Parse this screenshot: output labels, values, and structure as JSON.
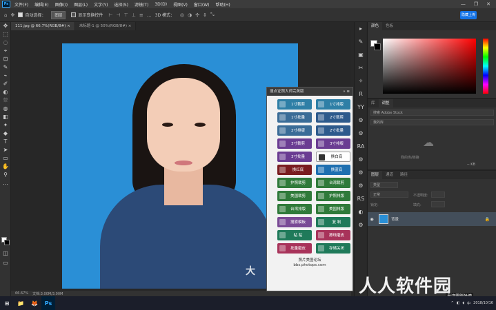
{
  "menubar": {
    "logo": "Ps",
    "items": [
      "文件(F)",
      "编辑(E)",
      "图像(I)",
      "图层(L)",
      "文字(Y)",
      "选择(S)",
      "滤镜(T)",
      "3D(D)",
      "视图(V)",
      "窗口(W)",
      "帮助(H)"
    ],
    "window_controls": [
      "—",
      "❐",
      "✕"
    ]
  },
  "options_bar": {
    "auto_select_label": "自动选择：",
    "auto_select_value": "图层",
    "show_transform_label": "显示变换控件",
    "mode_3d": "3D 模式：",
    "cloud_button": "隐藏上传"
  },
  "tabs": [
    {
      "label": "111.jpg @ 66.7%(RGB/8#) ×",
      "active": true
    },
    {
      "label": "未标题-1 @ 50%(RGB/8#) ×",
      "active": false
    }
  ],
  "tools": [
    "✥",
    "⬚",
    "◌",
    "⌖",
    "⊡",
    "✎",
    "⌁",
    "✐",
    "◐",
    "⛆",
    "◍",
    "◧",
    "✦",
    "◆",
    "T",
    "➤",
    "▭",
    "✋",
    "⚲",
    "…"
  ],
  "photo": {
    "watermark": "大"
  },
  "statusbar": {
    "zoom": "66.67%",
    "doc": "文档:3.00M/3.00M"
  },
  "plugin": {
    "title": "搜点证照大师完美版",
    "header_icons": "» ≡",
    "buttons": [
      {
        "label": "1寸裁剪",
        "color": "#2e7fa6"
      },
      {
        "label": "1寸排版",
        "color": "#2e7fa6"
      },
      {
        "label": "1寸批量",
        "color": "#3a6c97"
      },
      {
        "label": "2寸裁剪",
        "color": "#2d5a8c"
      },
      {
        "label": "2寸排版",
        "color": "#3a6c97"
      },
      {
        "label": "2寸批量",
        "color": "#2d5a8c"
      },
      {
        "label": "3寸裁剪",
        "color": "#6a3c92"
      },
      {
        "label": "3寸排版",
        "color": "#6a3c92"
      },
      {
        "label": "3寸批量",
        "color": "#6a3c92"
      },
      {
        "label": "换白底",
        "color": "#ffffff"
      },
      {
        "label": "换红底",
        "color": "#7a1c20"
      },
      {
        "label": "换蓝底",
        "color": "#1e6fb0"
      },
      {
        "label": "护照裁剪",
        "color": "#2f7a3a"
      },
      {
        "label": "台湾裁剪",
        "color": "#2f7a3a"
      },
      {
        "label": "美国裁剪",
        "color": "#2f7a3a"
      },
      {
        "label": "护照排版",
        "color": "#2f7a3a"
      },
      {
        "label": "台湾排版",
        "color": "#2f7a3a"
      },
      {
        "label": "美国排版",
        "color": "#2f7a3a"
      },
      {
        "label": "搜索模板",
        "color": "#7a4a96"
      },
      {
        "label": "复 制",
        "color": "#1f7a5a"
      },
      {
        "label": "粘 贴",
        "color": "#1f7a5a"
      },
      {
        "label": "擦线磨皮",
        "color": "#a8335a"
      },
      {
        "label": "批量磨皮",
        "color": "#a8335a"
      },
      {
        "label": "存储关闭",
        "color": "#1f7a5a"
      }
    ],
    "footer_line1": "照片美图论坛",
    "footer_line2": "bbs.photops.com"
  },
  "icon_strip": [
    "▸",
    "✎",
    "▣",
    "✂",
    "✧",
    "R",
    "YY",
    "⚙",
    "⚙",
    "RA",
    "⚙",
    "⚙",
    "⚙",
    "RS",
    "◐",
    "⚙"
  ],
  "right_panel": {
    "color_tabs": [
      "颜色",
      "色板"
    ],
    "adjust_tabs": [
      "库",
      "调整"
    ],
    "search_placeholder": "搜索 Adobe Stock",
    "lib_select": "我的库",
    "lib_label": "我的库/链接",
    "lib_size": "-- KB",
    "layer_tabs": [
      "图层",
      "通道",
      "路径"
    ],
    "kind": "类型",
    "blend": "正常",
    "opacity_label": "不透明度:",
    "lock_label": "锁定:",
    "fill_label": "填充:",
    "layer_name": "背景"
  },
  "taskbar": {
    "start": "⊞",
    "apps": [
      "📁",
      "🦊",
      "Ps"
    ],
    "tray_text": "中",
    "date": "2018/10/16"
  },
  "site_watermark": "人人软件园",
  "site_watermark_sub": "台湾電腦論壇"
}
